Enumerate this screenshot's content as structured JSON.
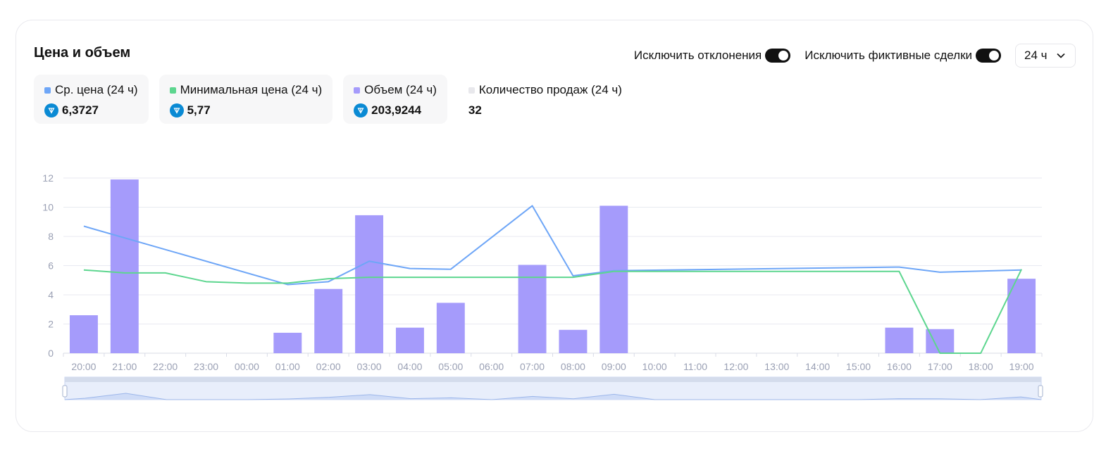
{
  "header": {
    "title": "Цена и объем"
  },
  "filters": {
    "exclude_outliers_label": "Исключить отклонения",
    "exclude_outliers_on": true,
    "exclude_fake_label": "Исключить фиктивные сделки",
    "exclude_fake_on": true,
    "period_value": "24 ч"
  },
  "stats": {
    "avg_price": {
      "label": "Ср. цена (24 ч)",
      "value": "6,3727",
      "color": "#6ea6f7",
      "icon": "ton-icon"
    },
    "min_price": {
      "label": "Минимальная цена (24 ч)",
      "value": "5,77",
      "color": "#5dd68f",
      "icon": "ton-icon"
    },
    "volume": {
      "label": "Объем (24 ч)",
      "value": "203,9244",
      "color": "#a59bfb",
      "icon": "ton-icon"
    },
    "sales_count": {
      "label": "Количество продаж (24 ч)",
      "value": "32",
      "color": "#e8e8ec"
    }
  },
  "chart_data": {
    "type": "bar",
    "categories": [
      "20:00",
      "21:00",
      "22:00",
      "23:00",
      "00:00",
      "01:00",
      "02:00",
      "03:00",
      "04:00",
      "05:00",
      "06:00",
      "07:00",
      "08:00",
      "09:00",
      "10:00",
      "11:00",
      "12:00",
      "13:00",
      "14:00",
      "15:00",
      "16:00",
      "17:00",
      "18:00",
      "19:00"
    ],
    "ylim": [
      0,
      12
    ],
    "yticks": [
      0,
      2,
      4,
      6,
      8,
      10,
      12
    ],
    "grid": true,
    "series": [
      {
        "type": "bar",
        "color": "#a59bfb",
        "values": [
          2.6,
          11.9,
          null,
          null,
          null,
          1.4,
          4.4,
          9.45,
          1.75,
          3.45,
          null,
          6.05,
          1.6,
          10.1,
          null,
          null,
          null,
          null,
          null,
          null,
          1.75,
          1.65,
          null,
          5.1
        ]
      },
      {
        "type": "line",
        "color": "#6ea6f7",
        "values": [
          8.7,
          null,
          null,
          null,
          null,
          4.7,
          4.9,
          6.3,
          5.8,
          5.75,
          null,
          10.1,
          5.3,
          5.65,
          null,
          null,
          null,
          null,
          null,
          null,
          5.9,
          5.55,
          null,
          5.7
        ]
      },
      {
        "type": "line",
        "color": "#5dd68f",
        "values": [
          5.7,
          5.5,
          5.5,
          4.9,
          4.8,
          4.8,
          5.1,
          5.2,
          5.2,
          5.2,
          5.2,
          5.2,
          5.2,
          5.6,
          5.6,
          5.6,
          5.6,
          5.6,
          5.6,
          5.6,
          5.6,
          0,
          0,
          5.75
        ]
      }
    ]
  }
}
